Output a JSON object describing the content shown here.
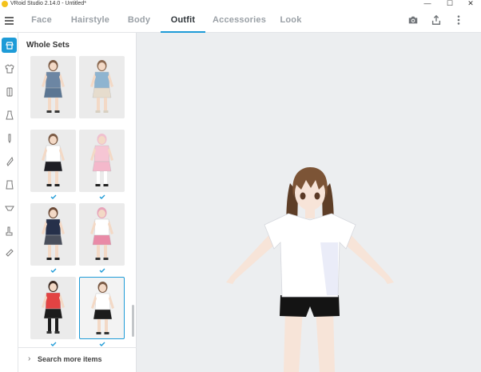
{
  "window": {
    "title": "VRoid Studio 2.14.0 - Untitled*",
    "controls": {
      "minimize": "—",
      "maximize": "☐",
      "close": "✕"
    }
  },
  "tabs": [
    {
      "label": "Face",
      "active": false
    },
    {
      "label": "Hairstyle",
      "active": false
    },
    {
      "label": "Body",
      "active": false
    },
    {
      "label": "Outfit",
      "active": true
    },
    {
      "label": "Accessories",
      "active": false
    },
    {
      "label": "Look",
      "active": false
    }
  ],
  "toolbar_icons": [
    "camera-icon",
    "share-icon",
    "more-vert-icon"
  ],
  "rail_icons": [
    "outfit-set-icon",
    "tops-icon",
    "jacket-icon",
    "onepiece-icon",
    "bottoms-icon",
    "socks-icon",
    "shoes-icon",
    "gloves-icon",
    "underwear-icon",
    "boots-icon",
    "accessory-icon"
  ],
  "panel": {
    "title": "Whole Sets",
    "search_more": "Search more items"
  },
  "outfits": [
    {
      "name": "denim-shorts-set",
      "skin": "#f3d9c6",
      "top": "#6c86a3",
      "bottom": "#5b7693",
      "legs": "#f3d9c6",
      "shoes": "#3a3a3a",
      "hair": "#7a5a44",
      "checked": false
    },
    {
      "name": "flowy-dress-set",
      "skin": "#f3d9c6",
      "top": "#8eb4d0",
      "bottom": "#e6dccd",
      "legs": "#f3d9c6",
      "shoes": "#d8d0c2",
      "hair": "#8c6a52",
      "checked": false
    },
    {
      "name": "sailor-uniform-set",
      "skin": "#f3d9c6",
      "top": "#ffffff",
      "bottom": "#1e1e24",
      "legs": "#f3d9c6",
      "shoes": "#222222",
      "hair": "#7a5a44",
      "checked": true
    },
    {
      "name": "pink-maid-set",
      "skin": "#f3d9c6",
      "top": "#f6c6d4",
      "bottom": "#f4b8cb",
      "legs": "#ffffff",
      "shoes": "#222222",
      "hair": "#f0c0cf",
      "checked": true
    },
    {
      "name": "navy-blazer-set",
      "skin": "#f3d9c6",
      "top": "#26304a",
      "bottom": "#4a4f5c",
      "legs": "#f3d9c6",
      "shoes": "#222222",
      "hair": "#6b4a36",
      "checked": true
    },
    {
      "name": "pink-check-skirt-set",
      "skin": "#f3d9c6",
      "top": "#ffffff",
      "bottom": "#e98aa7",
      "legs": "#f3d9c6",
      "shoes": "#333333",
      "hair": "#e7a4ba",
      "checked": true
    },
    {
      "name": "red-sweater-set",
      "skin": "#f3d9c6",
      "top": "#e24343",
      "bottom": "#1c1c1c",
      "legs": "#1c1c1c",
      "shoes": "#333333",
      "hair": "#3d2b22",
      "checked": true
    },
    {
      "name": "white-tee-shorts-set",
      "skin": "#f3d9c6",
      "top": "#ffffff",
      "bottom": "#1c1c1c",
      "legs": "#f3d9c6",
      "shoes": "#333333",
      "hair": "#7a5a44",
      "checked": true,
      "selected": true
    }
  ],
  "avatar": {
    "hair": "#7c5436",
    "hair_dark": "#5e3e27",
    "skin": "#f7e4d8",
    "shirt": "#ffffff",
    "shirt_shade": "#d9dcf2",
    "shorts": "#141414"
  },
  "colors": {
    "accent": "#1e9bd7"
  }
}
